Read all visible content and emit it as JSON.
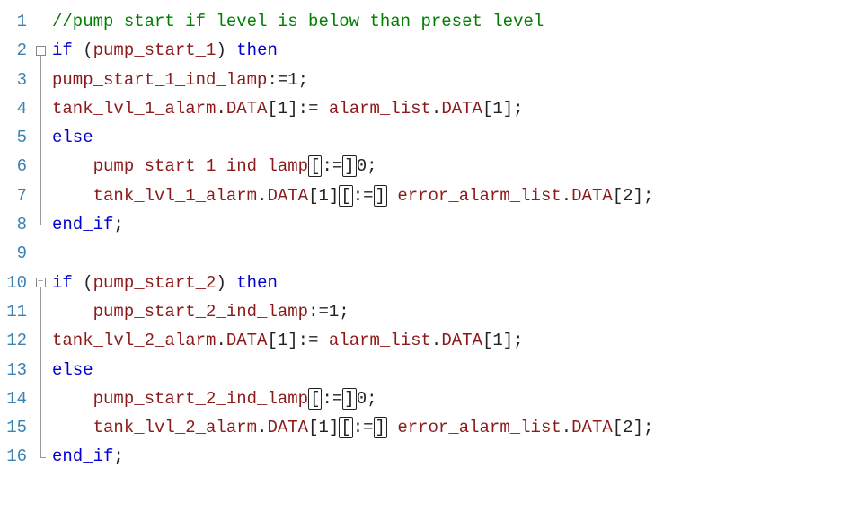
{
  "lines": [
    {
      "n": 1,
      "fold": "",
      "tokens": [
        {
          "cls": "tok-comment",
          "t": "//pump start if level is below than preset level"
        }
      ]
    },
    {
      "n": 2,
      "fold": "start",
      "tokens": [
        {
          "cls": "tok-keyword",
          "t": "if"
        },
        {
          "cls": "tok-punct",
          "t": " ("
        },
        {
          "cls": "tok-ident",
          "t": "pump_start_1"
        },
        {
          "cls": "tok-punct",
          "t": ") "
        },
        {
          "cls": "tok-keyword",
          "t": "then"
        }
      ]
    },
    {
      "n": 3,
      "fold": "mid",
      "tokens": [
        {
          "cls": "tok-ident",
          "t": "pump_start_1_ind_lamp"
        },
        {
          "cls": "tok-punct",
          "t": ":="
        },
        {
          "cls": "tok-num",
          "t": "1"
        },
        {
          "cls": "tok-punct",
          "t": ";"
        }
      ]
    },
    {
      "n": 4,
      "fold": "mid",
      "tokens": [
        {
          "cls": "tok-ident",
          "t": "tank_lvl_1_alarm"
        },
        {
          "cls": "tok-punct",
          "t": "."
        },
        {
          "cls": "tok-member",
          "t": "DATA"
        },
        {
          "cls": "tok-bracket",
          "t": "["
        },
        {
          "cls": "tok-num",
          "t": "1"
        },
        {
          "cls": "tok-bracket",
          "t": "]"
        },
        {
          "cls": "tok-punct",
          "t": ":= "
        },
        {
          "cls": "tok-ident",
          "t": "alarm_list"
        },
        {
          "cls": "tok-punct",
          "t": "."
        },
        {
          "cls": "tok-member",
          "t": "DATA"
        },
        {
          "cls": "tok-bracket",
          "t": "["
        },
        {
          "cls": "tok-num",
          "t": "1"
        },
        {
          "cls": "tok-bracket",
          "t": "]"
        },
        {
          "cls": "tok-punct",
          "t": ";"
        }
      ]
    },
    {
      "n": 5,
      "fold": "mid",
      "tokens": [
        {
          "cls": "tok-keyword",
          "t": "else"
        }
      ]
    },
    {
      "n": 6,
      "fold": "mid",
      "indent": 1,
      "tokens": [
        {
          "cls": "tok-ident",
          "t": "pump_start_1_ind_lamp"
        },
        {
          "cls": "tok-bracket boxed",
          "t": "["
        },
        {
          "cls": "tok-punct",
          "t": ":="
        },
        {
          "cls": "tok-bracket boxed",
          "t": "]"
        },
        {
          "cls": "tok-num",
          "t": "0"
        },
        {
          "cls": "tok-punct",
          "t": ";"
        }
      ]
    },
    {
      "n": 7,
      "fold": "mid",
      "indent": 1,
      "tokens": [
        {
          "cls": "tok-ident",
          "t": "tank_lvl_1_alarm"
        },
        {
          "cls": "tok-punct",
          "t": "."
        },
        {
          "cls": "tok-member",
          "t": "DATA"
        },
        {
          "cls": "tok-bracket",
          "t": "["
        },
        {
          "cls": "tok-num",
          "t": "1"
        },
        {
          "cls": "tok-bracket",
          "t": "]"
        },
        {
          "cls": "tok-bracket boxed",
          "t": "["
        },
        {
          "cls": "tok-punct",
          "t": ":="
        },
        {
          "cls": "tok-bracket boxed",
          "t": "]"
        },
        {
          "cls": "tok-punct",
          "t": " "
        },
        {
          "cls": "tok-ident",
          "t": "error_alarm_list"
        },
        {
          "cls": "tok-punct",
          "t": "."
        },
        {
          "cls": "tok-member",
          "t": "DATA"
        },
        {
          "cls": "tok-bracket",
          "t": "["
        },
        {
          "cls": "tok-num",
          "t": "2"
        },
        {
          "cls": "tok-bracket",
          "t": "]"
        },
        {
          "cls": "tok-punct",
          "t": ";"
        }
      ]
    },
    {
      "n": 8,
      "fold": "end",
      "tokens": [
        {
          "cls": "tok-keyword",
          "t": "end_if"
        },
        {
          "cls": "tok-punct",
          "t": ";"
        }
      ]
    },
    {
      "n": 9,
      "fold": "",
      "tokens": []
    },
    {
      "n": 10,
      "fold": "start",
      "tokens": [
        {
          "cls": "tok-keyword",
          "t": "if"
        },
        {
          "cls": "tok-punct",
          "t": " ("
        },
        {
          "cls": "tok-ident",
          "t": "pump_start_2"
        },
        {
          "cls": "tok-punct",
          "t": ") "
        },
        {
          "cls": "tok-keyword",
          "t": "then"
        }
      ]
    },
    {
      "n": 11,
      "fold": "mid",
      "indent": 1,
      "tokens": [
        {
          "cls": "tok-ident",
          "t": "pump_start_2_ind_lamp"
        },
        {
          "cls": "tok-punct",
          "t": ":="
        },
        {
          "cls": "tok-num",
          "t": "1"
        },
        {
          "cls": "tok-punct",
          "t": ";"
        }
      ]
    },
    {
      "n": 12,
      "fold": "mid",
      "tokens": [
        {
          "cls": "tok-ident",
          "t": "tank_lvl_2_alarm"
        },
        {
          "cls": "tok-punct",
          "t": "."
        },
        {
          "cls": "tok-member",
          "t": "DATA"
        },
        {
          "cls": "tok-bracket",
          "t": "["
        },
        {
          "cls": "tok-num",
          "t": "1"
        },
        {
          "cls": "tok-bracket",
          "t": "]"
        },
        {
          "cls": "tok-punct",
          "t": ":= "
        },
        {
          "cls": "tok-ident",
          "t": "alarm_list"
        },
        {
          "cls": "tok-punct",
          "t": "."
        },
        {
          "cls": "tok-member",
          "t": "DATA"
        },
        {
          "cls": "tok-bracket",
          "t": "["
        },
        {
          "cls": "tok-num",
          "t": "1"
        },
        {
          "cls": "tok-bracket",
          "t": "]"
        },
        {
          "cls": "tok-punct",
          "t": ";"
        }
      ]
    },
    {
      "n": 13,
      "fold": "mid",
      "tokens": [
        {
          "cls": "tok-keyword",
          "t": "else"
        }
      ]
    },
    {
      "n": 14,
      "fold": "mid",
      "indent": 1,
      "tokens": [
        {
          "cls": "tok-ident",
          "t": "pump_start_2_ind_lamp"
        },
        {
          "cls": "tok-bracket boxed",
          "t": "["
        },
        {
          "cls": "tok-punct",
          "t": ":="
        },
        {
          "cls": "tok-bracket boxed",
          "t": "]"
        },
        {
          "cls": "tok-num",
          "t": "0"
        },
        {
          "cls": "tok-punct",
          "t": ";"
        }
      ]
    },
    {
      "n": 15,
      "fold": "mid",
      "indent": 1,
      "tokens": [
        {
          "cls": "tok-ident",
          "t": "tank_lvl_2_alarm"
        },
        {
          "cls": "tok-punct",
          "t": "."
        },
        {
          "cls": "tok-member",
          "t": "DATA"
        },
        {
          "cls": "tok-bracket",
          "t": "["
        },
        {
          "cls": "tok-num",
          "t": "1"
        },
        {
          "cls": "tok-bracket",
          "t": "]"
        },
        {
          "cls": "tok-bracket boxed",
          "t": "["
        },
        {
          "cls": "tok-punct",
          "t": ":="
        },
        {
          "cls": "tok-bracket boxed",
          "t": "]"
        },
        {
          "cls": "tok-punct",
          "t": " "
        },
        {
          "cls": "tok-ident",
          "t": "error_alarm_list"
        },
        {
          "cls": "tok-punct",
          "t": "."
        },
        {
          "cls": "tok-member",
          "t": "DATA"
        },
        {
          "cls": "tok-bracket",
          "t": "["
        },
        {
          "cls": "tok-num",
          "t": "2"
        },
        {
          "cls": "tok-bracket",
          "t": "]"
        },
        {
          "cls": "tok-punct",
          "t": ";"
        }
      ]
    },
    {
      "n": 16,
      "fold": "end",
      "tokens": [
        {
          "cls": "tok-keyword",
          "t": "end_if"
        },
        {
          "cls": "tok-punct",
          "t": ";"
        }
      ]
    }
  ],
  "fold_glyph": "−"
}
